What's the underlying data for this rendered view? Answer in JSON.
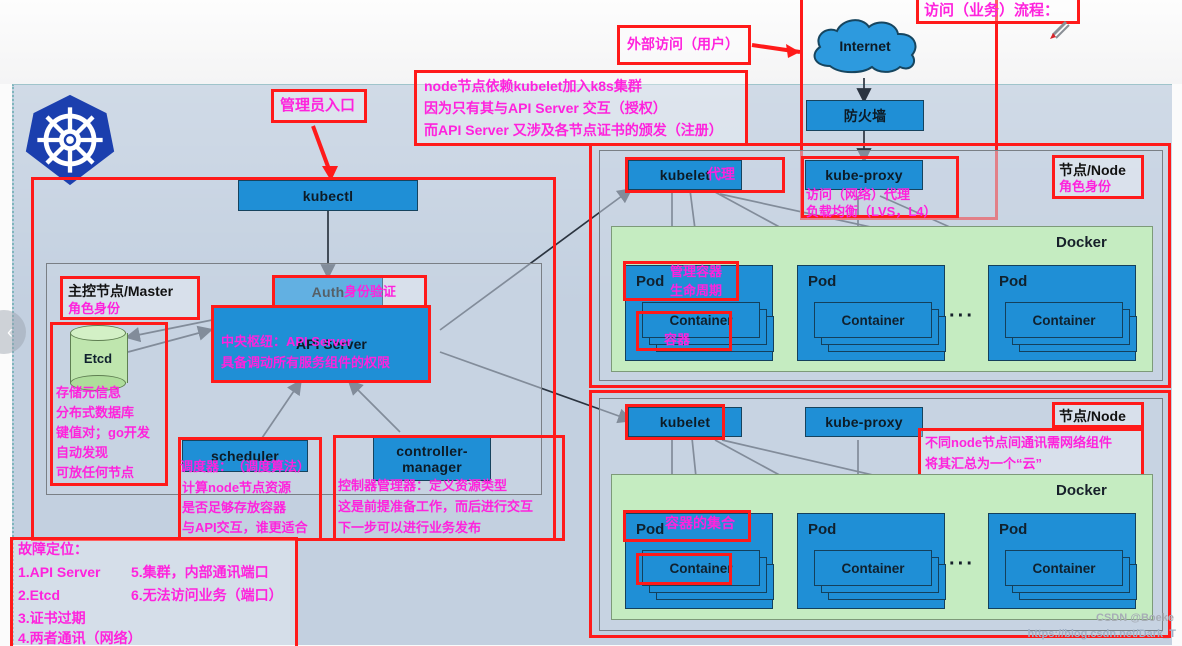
{
  "canvas": {
    "logo_name": "kubernetes-wheel-logo",
    "watermark_author": "CSDN @Boeke",
    "watermark_url": "https://blog.csdn.net/Dark_T"
  },
  "flow": {
    "internet": "Internet",
    "firewall": "防火墙",
    "title_note": "访问（业务）流程：",
    "external_note": "外部访问（用户）"
  },
  "admin": {
    "entry_note": "管理员入口",
    "kubectl": "kubectl",
    "kubelet_note_l1": "node节点依赖kubelet加入k8s集群",
    "kubelet_note_l2": "因为只有其与API Server 交互（授权）",
    "kubelet_note_l3": "而API Server 又涉及各节点证书的颁发（注册）"
  },
  "master": {
    "title": "主控节点/Master",
    "title_note": "角色身份",
    "auth": "Auth",
    "auth_note": "身份验证",
    "apiserver": "API Server",
    "apiserver_note_l1": "中央枢纽：API Server",
    "apiserver_note_l2": "具备调动所有服务组件的权限",
    "etcd": "Etcd",
    "etcd_note_l1": "存储元信息",
    "etcd_note_l2": "分布式数据库",
    "etcd_note_l3": "键值对；go开发",
    "etcd_note_l4": "自动发现",
    "etcd_note_l5": "可放任何节点",
    "scheduler": "scheduler",
    "scheduler_note_l1": "调度器：　（调度算法）",
    "scheduler_note_l2": "计算node节点资源",
    "scheduler_note_l3": "是否足够存放容器",
    "scheduler_note_l4": "与API交互，谁更适合",
    "controller_l1": "controller-",
    "controller_l2": "manager",
    "controller_note_l1": "控制器管理器：定义资源类型",
    "controller_note_l2": "这是前提准备工作，而后进行交互",
    "controller_note_l3": "下一步可以进行业务发布"
  },
  "trouble": {
    "title": "故障定位：",
    "items_left": [
      "1.API Server",
      "2.Etcd",
      "3.证书过期",
      "4.两者通讯（网络）"
    ],
    "items_right": [
      "5.集群，内部通讯端口",
      "6.无法访问业务（端口）"
    ]
  },
  "node1": {
    "role_title": "节点/Node",
    "role_note": "角色身份",
    "kubelet": "kubelet",
    "kubelet_note": "代理",
    "kube_proxy": "kube-proxy",
    "proxy_note_l1": "访问（网络）代理",
    "proxy_note_l2": "负载均衡（LVS，L4）",
    "docker": "Docker",
    "pod_note_l1": "管理容器",
    "pod_note_l2": "生命周期",
    "container_note": "容器",
    "ellipsis": "···",
    "pods": [
      {
        "label": "Pod",
        "container": "Container"
      },
      {
        "label": "Pod",
        "container": "Container"
      },
      {
        "label": "Pod",
        "container": "Container"
      }
    ]
  },
  "node2": {
    "role_title": "节点/Node",
    "net_note_l1": "不同node节点间通讯需网络组件",
    "net_note_l2": "将其汇总为一个“云”",
    "kubelet": "kubelet",
    "kube_proxy": "kube-proxy",
    "docker": "Docker",
    "pod_note": "容器的集合",
    "ellipsis": "···",
    "pods": [
      {
        "label": "Pod",
        "container": "Container"
      },
      {
        "label": "Pod",
        "container": "Container"
      },
      {
        "label": "Pod",
        "container": "Container"
      }
    ]
  },
  "chrome": {
    "collapse_icon": "‹",
    "pen_icon": "pen-icon"
  }
}
